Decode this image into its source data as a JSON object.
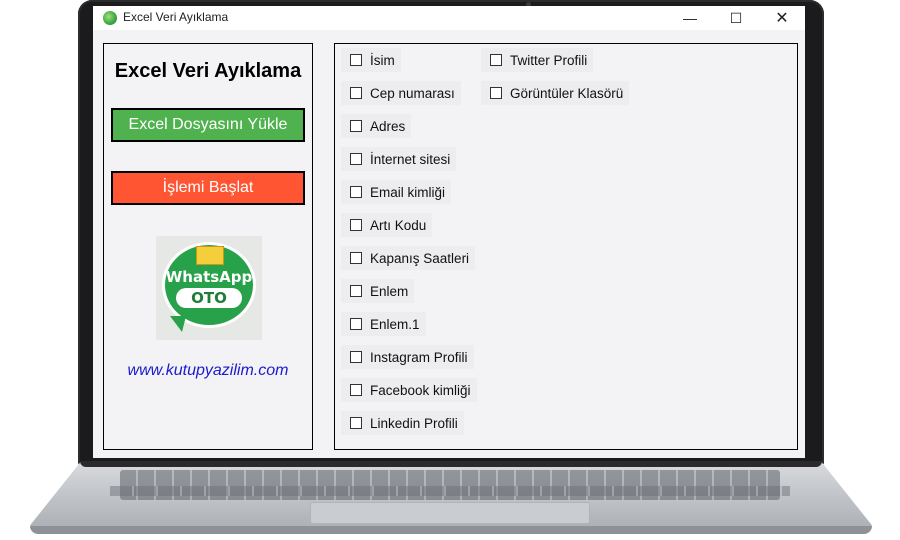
{
  "window": {
    "title": "Excel Veri Ayıklama",
    "controls": {
      "minimize": "—",
      "maximize": "☐",
      "close": "✕"
    }
  },
  "left_panel": {
    "heading": "Excel Veri Ayıklama",
    "load_button": "Excel Dosyasını Yükle",
    "start_button": "İşlemi Başlat",
    "logo_text_top": "WhatsApp",
    "logo_text_bottom": "OTO",
    "website": "www.kutupyazilim.com"
  },
  "checkboxes": {
    "column1": [
      {
        "label": "İsim",
        "checked": false
      },
      {
        "label": "Cep numarası",
        "checked": false
      },
      {
        "label": "Adres",
        "checked": false
      },
      {
        "label": "İnternet sitesi",
        "checked": false
      },
      {
        "label": "Email kimliği",
        "checked": false
      },
      {
        "label": "Artı Kodu",
        "checked": false
      },
      {
        "label": "Kapanış Saatleri",
        "checked": false
      },
      {
        "label": "Enlem",
        "checked": false
      },
      {
        "label": "Enlem.1",
        "checked": false
      },
      {
        "label": "Instagram Profili",
        "checked": false
      },
      {
        "label": "Facebook kimliği",
        "checked": false
      },
      {
        "label": "Linkedin Profili",
        "checked": false
      }
    ],
    "column2": [
      {
        "label": "Twitter Profili",
        "checked": false
      },
      {
        "label": "Görüntüler Klasörü",
        "checked": false
      }
    ]
  },
  "colors": {
    "load_button": "#4fb24f",
    "start_button": "#ff5533",
    "website_link": "#1a1acc"
  }
}
